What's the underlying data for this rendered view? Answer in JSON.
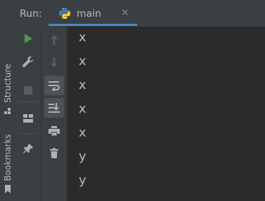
{
  "tool_window": {
    "run_label": "Run:",
    "tab": {
      "label": "main",
      "close_glyph": "×",
      "icon": "python-icon"
    }
  },
  "left_stripe": {
    "items": [
      {
        "label": "Structure",
        "icon": "structure-icon"
      },
      {
        "label": "Bookmarks",
        "icon": "bookmark-icon"
      }
    ]
  },
  "toolbar": {
    "primary": [
      "run-icon",
      "wrench-icon",
      "stop-icon",
      "layout-icon",
      "pin-icon"
    ],
    "secondary": [
      "arrow-up-icon",
      "arrow-down-icon",
      "soft-wrap-icon",
      "scroll-to-end-icon",
      "print-icon",
      "trash-icon"
    ]
  },
  "console": {
    "lines": [
      "x",
      "x",
      "x",
      "x",
      "x",
      "y",
      "y"
    ]
  },
  "colors": {
    "background": "#2b2b2b",
    "panel": "#3c3f41",
    "text": "#bbbbbb",
    "run_green": "#499c54",
    "tab_accent": "#4a88c7"
  }
}
